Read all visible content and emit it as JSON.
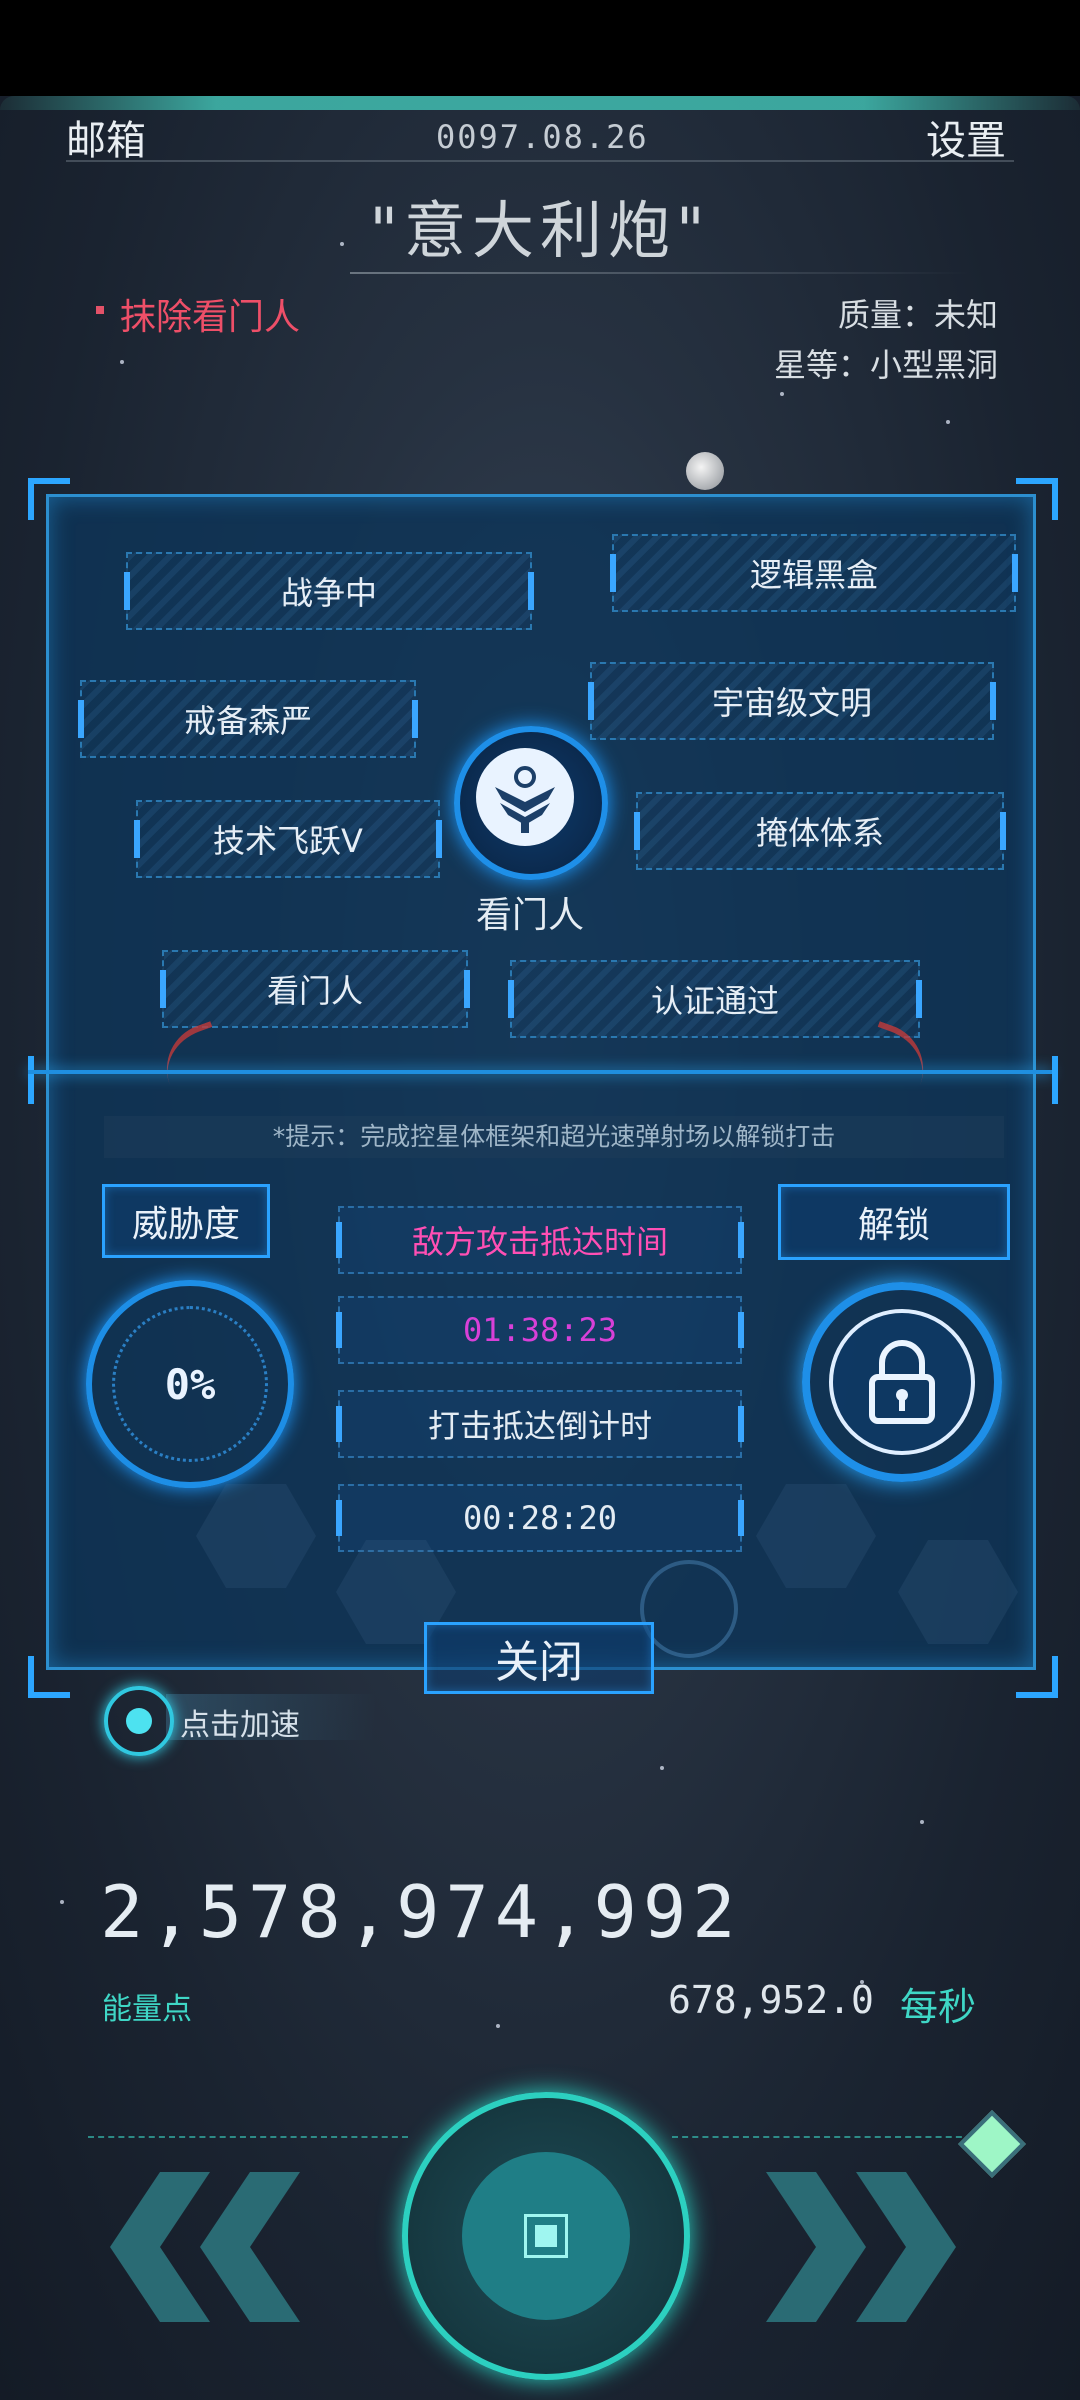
{
  "header": {
    "mailbox_label": "邮箱",
    "date": "0097.08.26",
    "settings_label": "设置",
    "planet_name": "\"意大利炮\""
  },
  "target": {
    "erase_label": "抹除看门人",
    "mass": "质量：未知",
    "rank": "星等：小型黑洞"
  },
  "panel": {
    "tags": [
      "战争中",
      "逻辑黑盒",
      "戒备森严",
      "宇宙级文明",
      "技术飞跃V",
      "掩体体系",
      "看门人",
      "认证通过"
    ],
    "emblem_label": "看门人",
    "hint": "*提示：完成控星体框架和超光速弹射场以解锁打击",
    "threat_label": "威胁度",
    "threat_value": "0%",
    "unlock_label": "解锁",
    "enemy_arrival_label": "敌方攻击抵达时间",
    "enemy_arrival_time": "01:38:23",
    "strike_countdown_label": "打击抵达倒计时",
    "strike_countdown_time": "00:28:20",
    "close_label": "关闭"
  },
  "speedup": {
    "label": "点击加速"
  },
  "energy": {
    "value": "2,578,974,992",
    "label": "能量点",
    "rate_value": "678,952.0",
    "rate_unit": "每秒"
  },
  "colors": {
    "accent_blue": "#2aa2ff",
    "accent_teal": "#3fd7c6",
    "alert_red": "#ee4f68",
    "enemy_pink": "#ff4fb4"
  }
}
